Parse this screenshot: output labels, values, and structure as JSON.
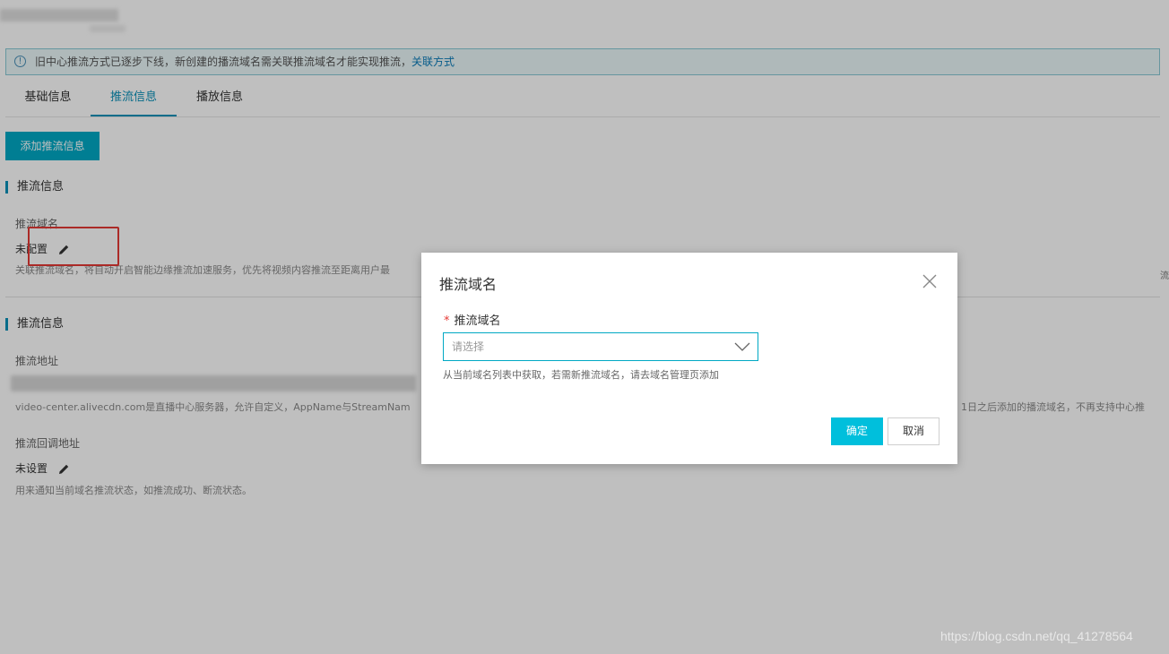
{
  "notice": {
    "text": "旧中心推流方式已逐步下线，新创建的播流域名需关联推流域名才能实现推流，",
    "link": "关联方式"
  },
  "tabs": [
    {
      "label": "基础信息"
    },
    {
      "label": "推流信息"
    },
    {
      "label": "播放信息"
    }
  ],
  "toolbar": {
    "add_button": "添加推流信息"
  },
  "section1": {
    "title": "推流信息",
    "field_label": "推流域名",
    "value": "未配置",
    "desc": "关联推流域名，将自动开启智能边缘推流加速服务，优先将视频内容推流至距离用户最"
  },
  "section2": {
    "title": "推流信息",
    "address_label": "推流地址",
    "address_desc": "video-center.alivecdn.com是直播中心服务器，允许自定义，AppName与StreamNam",
    "right_desc": "1日之后添加的播流域名，不再支持中心推",
    "callback_label": "推流回调地址",
    "callback_value": "未设置",
    "callback_desc": "用来通知当前域名推流状态，如推流成功、断流状态。"
  },
  "edge_text": "流",
  "dialog": {
    "title": "推流域名",
    "required_mark": "*",
    "field_label": "推流域名",
    "select_placeholder": "请选择",
    "hint": "从当前域名列表中获取，若需新推流域名，请去域名管理页添加",
    "ok_label": "确定",
    "cancel_label": "取消"
  },
  "watermark": "https://blog.csdn.net/qq_41278564",
  "colors": {
    "accent": "#00a8c4",
    "ok_button": "#00bfdc",
    "required": "#e53935",
    "highlight_box": "#e53935"
  }
}
